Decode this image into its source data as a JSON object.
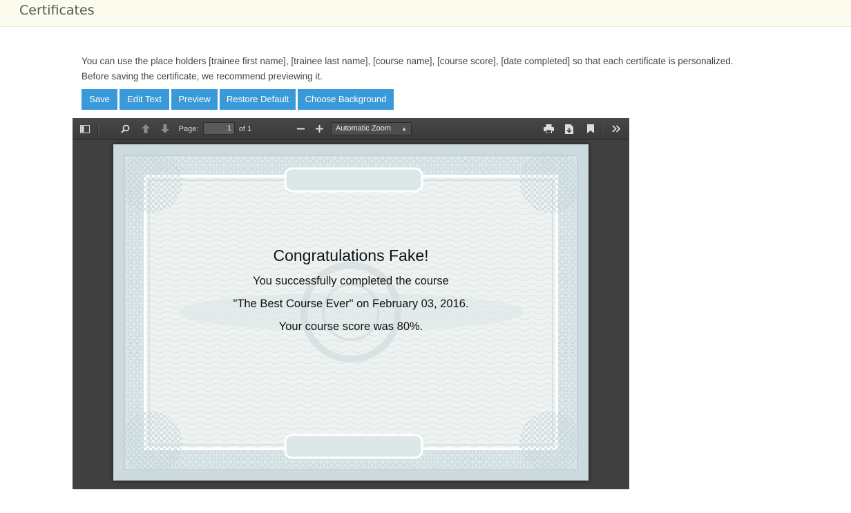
{
  "header": {
    "title": "Certificates"
  },
  "instructions": {
    "line1": "You can use the place holders [trainee first name], [trainee last name], [course name], [course score], [date completed] so that each certificate is personalized.",
    "line2": "Before saving the certificate, we recommend previewing it."
  },
  "buttons": {
    "save": "Save",
    "edit_text": "Edit Text",
    "preview": "Preview",
    "restore_default": "Restore Default",
    "choose_background": "Choose Background"
  },
  "viewer": {
    "page_label": "Page:",
    "page_value": "1",
    "page_of": "of 1",
    "zoom": "Automatic Zoom",
    "icons": [
      "sidebar-toggle-icon",
      "search-icon",
      "previous-page-icon",
      "next-page-icon",
      "zoom-out-icon",
      "zoom-in-icon",
      "print-icon",
      "download-icon",
      "bookmark-icon",
      "tools-icon"
    ]
  },
  "certificate": {
    "heading": "Congratulations Fake!",
    "line1": "You successfully completed the course",
    "line2": "\"The Best Course Ever\" on February 03, 2016.",
    "line3": "Your course score was 80%."
  },
  "colors": {
    "accent": "#3a9ad9",
    "header_bg": "#fbfbee",
    "viewer_bg": "#404040",
    "paper_border": "#cddbe0"
  }
}
